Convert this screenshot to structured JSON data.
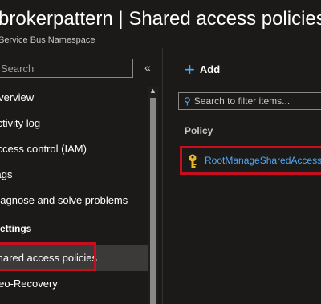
{
  "header": {
    "title": "brokerpattern | Shared access policies",
    "subtitle": "Service Bus Namespace"
  },
  "sidebar": {
    "search_placeholder": "Search",
    "collapse_glyph": "«",
    "items": [
      {
        "label": "Overview"
      },
      {
        "label": "Activity log"
      },
      {
        "label": "Access control (IAM)"
      },
      {
        "label": "Tags"
      },
      {
        "label": "Diagnose and solve problems"
      }
    ],
    "section_label": "Settings",
    "settings_items": [
      {
        "label": "Shared access policies",
        "selected": true
      },
      {
        "label": "Geo-Recovery"
      }
    ]
  },
  "toolbar": {
    "add_label": "Add"
  },
  "filter": {
    "placeholder": "Search to filter items..."
  },
  "table": {
    "column_header": "Policy",
    "rows": [
      {
        "name": "RootManageSharedAccessKey",
        "icon": "key-icon"
      }
    ]
  },
  "colors": {
    "background": "#1b1a19",
    "link": "#4fa8f5",
    "highlight": "#c50f1f",
    "selected": "#3b3a39"
  }
}
